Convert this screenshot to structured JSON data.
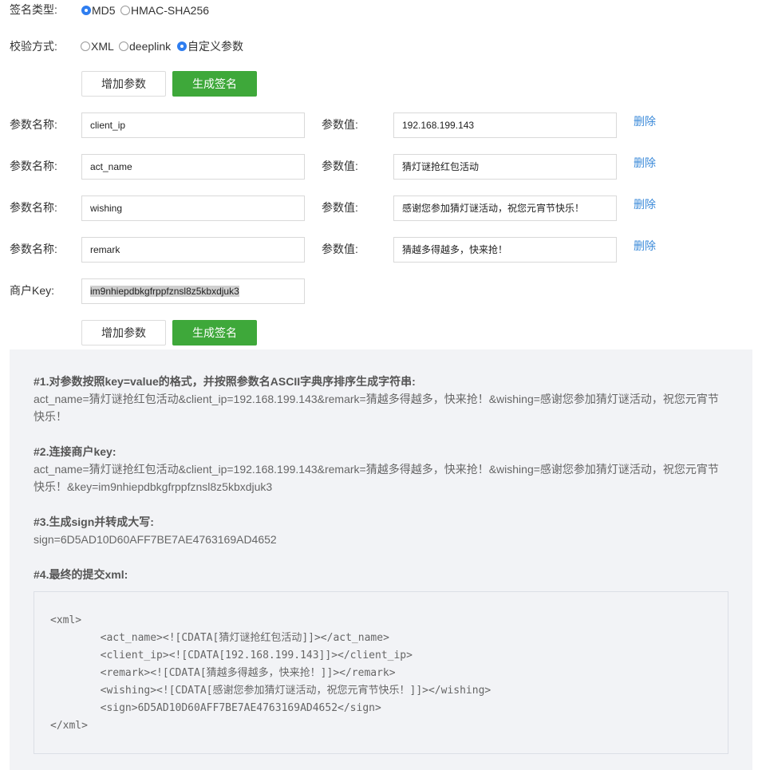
{
  "sign_type": {
    "label": "签名类型:",
    "options": [
      {
        "label": "MD5",
        "selected": true
      },
      {
        "label": "HMAC-SHA256",
        "selected": false
      }
    ]
  },
  "verify_mode": {
    "label": "校验方式:",
    "options": [
      {
        "label": "XML",
        "selected": false
      },
      {
        "label": "deeplink",
        "selected": false
      },
      {
        "label": "自定义参数",
        "selected": true
      }
    ]
  },
  "buttons": {
    "add_param": "增加参数",
    "gen_sign": "生成签名"
  },
  "params": {
    "name_label": "参数名称:",
    "value_label": "参数值:",
    "delete_label": "删除",
    "rows": [
      {
        "name": "client_ip",
        "value": "192.168.199.143"
      },
      {
        "name": "act_name",
        "value": "猜灯谜抢红包活动"
      },
      {
        "name": "wishing",
        "value": "感谢您参加猜灯谜活动，祝您元宵节快乐！"
      },
      {
        "name": "remark",
        "value": "猜越多得越多，快来抢！"
      }
    ]
  },
  "merchant_key": {
    "label": "商户Key:",
    "value": "im9nhiepdbkgfrppfznsl8z5kbxdjuk3"
  },
  "steps": {
    "s1_title": "#1.对参数按照key=value的格式，并按照参数名ASCII字典序排序生成字符串:",
    "s1_line1": "act_name=猜灯谜抢红包活动&client_ip=192.168.199.143&remark=猜越多得越多，快来抢！&wishing=感谢您参加猜灯谜活动，祝您元宵节",
    "s1_line2": "快乐！",
    "s2_title": "#2.连接商户key:",
    "s2_line1": "act_name=猜灯谜抢红包活动&client_ip=192.168.199.143&remark=猜越多得越多，快来抢！&wishing=感谢您参加猜灯谜活动，祝您元宵节",
    "s2_line2": "快乐！&key=im9nhiepdbkgfrppfznsl8z5kbxdjuk3",
    "s3_title": "#3.生成sign并转成大写:",
    "s3_text": "sign=6D5AD10D60AFF7BE7AE4763169AD4652",
    "s4_title": "#4.最终的提交xml:"
  },
  "xml_lines": [
    "<xml>",
    "        <act_name><![CDATA[猜灯谜抢红包活动]]></act_name>",
    "        <client_ip><![CDATA[192.168.199.143]]></client_ip>",
    "        <remark><![CDATA[猜越多得越多，快来抢！]]></remark>",
    "        <wishing><![CDATA[感谢您参加猜灯谜活动，祝您元宵节快乐！]]></wishing>",
    "        <sign>6D5AD10D60AFF7BE7AE4763169AD4652</sign>",
    "</xml>"
  ]
}
